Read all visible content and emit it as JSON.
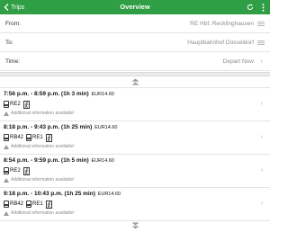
{
  "header": {
    "back_label": "Trips",
    "title": "Overview",
    "icons": [
      "back-chevron-icon",
      "refresh-icon",
      "more-vertical-icon"
    ],
    "color": "#2f9e44"
  },
  "form": {
    "from_label": "From:",
    "from_value": "RE Hbf, Recklinghausen",
    "to_label": "To:",
    "to_value": "Hauptbahnhof Düsseldorf",
    "time_label": "Time:",
    "time_value": "Depart Now"
  },
  "trips": [
    {
      "time": "7:56 p.m. - 8:59 p.m. (1h 3 min)",
      "price": "EUR14.60",
      "legs": [
        "RE2"
      ],
      "info": "Additional information available!"
    },
    {
      "time": "8:18 p.m. - 9:43 p.m. (1h 25 min)",
      "price": "EUR14.60",
      "legs": [
        "RB42",
        "RE1"
      ],
      "info": "Additional information available!"
    },
    {
      "time": "8:54 p.m. - 9:59 p.m. (1h 5 min)",
      "price": "EUR14.60",
      "legs": [
        "RE2"
      ],
      "info": "Additional information available!"
    },
    {
      "time": "9:18 p.m. - 10:43 p.m. (1h 25 min)",
      "price": "EUR14.60",
      "legs": [
        "RB42",
        "RE1"
      ],
      "info": "Additional information available!"
    }
  ]
}
